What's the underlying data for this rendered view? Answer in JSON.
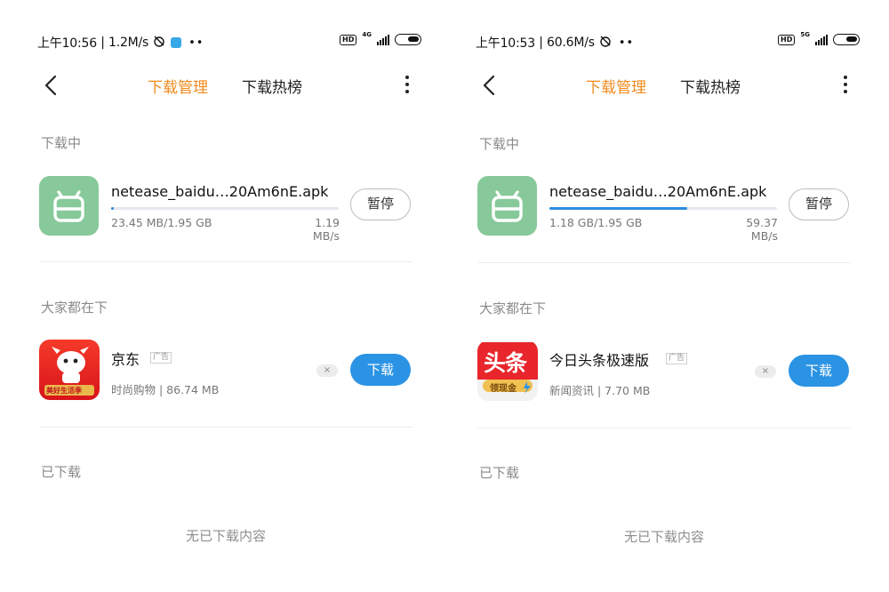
{
  "screens": [
    {
      "status": {
        "time": "上午10:56",
        "speed": "1.2M/s",
        "network": "4G"
      },
      "nav": {
        "tab_active": "下载管理",
        "tab_other": "下载热榜"
      },
      "sections": {
        "downloading": "大家都在下",
        "downloading_title": "下载中",
        "downloaded": "已下载"
      },
      "download": {
        "name": "netease_baidu…20Am6nE.apk",
        "size": "23.45 MB/1.95 GB",
        "speed": "1.19 MB/s",
        "progress": 0.012,
        "button": "暂停"
      },
      "ad": {
        "name": "京东",
        "tag": "广告",
        "meta": "时尚购物 | 86.74 MB",
        "button": "下载",
        "close": "×",
        "icon": "jd-app-icon",
        "icon_caption": "美好生活季"
      },
      "empty": "无已下载内容"
    },
    {
      "status": {
        "time": "上午10:53",
        "speed": "60.6M/s",
        "network": "5G"
      },
      "nav": {
        "tab_active": "下载管理",
        "tab_other": "下载热榜"
      },
      "sections": {
        "downloading": "大家都在下",
        "downloading_title": "下载中",
        "downloaded": "已下载"
      },
      "download": {
        "name": "netease_baidu…20Am6nE.apk",
        "size": "1.18 GB/1.95 GB",
        "speed": "59.37 MB/s",
        "progress": 0.605,
        "button": "暂停"
      },
      "ad": {
        "name": "今日头条极速版",
        "tag": "广告",
        "meta": "新闻资讯 | 7.70 MB",
        "button": "下载",
        "close": "×",
        "icon": "toutiao-app-icon",
        "icon_caption": "领现金",
        "icon_title": "头条"
      },
      "empty": "无已下载内容"
    }
  ],
  "colors": {
    "accent": "#f08a1c",
    "primary": "#2b93e4",
    "android_icon": "#87c99a",
    "progress": "#2b8bde"
  }
}
